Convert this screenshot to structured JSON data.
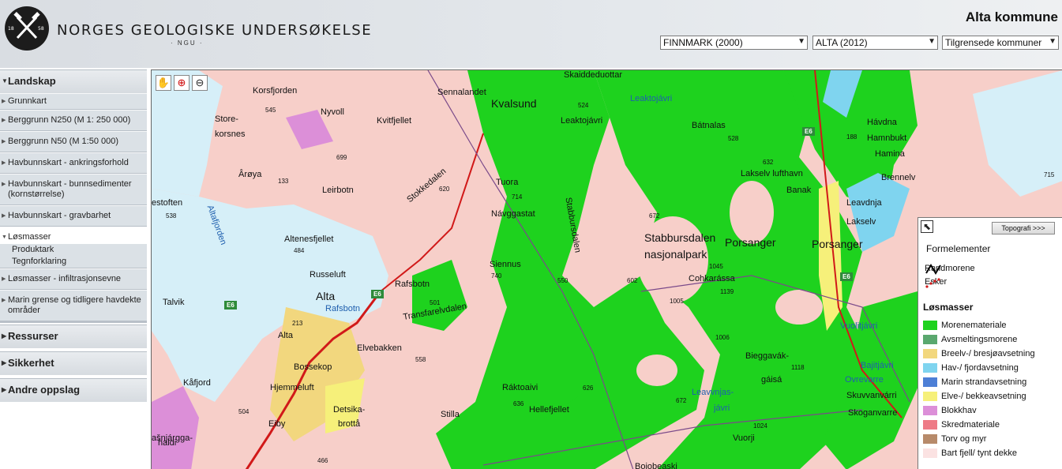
{
  "header": {
    "org_name": "NORGES GEOLOGISKE UNDERSØKELSE",
    "org_abbr": "· NGU ·",
    "logo_year_left": "18",
    "logo_year_right": "58",
    "kommune_title": "Alta kommune",
    "county_select": "FINNMARK (2000)",
    "municipality_select": "ALTA (2012)",
    "neighbors_select": "Tilgrensede kommuner"
  },
  "sidebar": {
    "categories": {
      "landskap": "Landskap",
      "ressurser": "Ressurser",
      "sikkerhet": "Sikkerhet",
      "andre": "Andre oppslag"
    },
    "items": [
      {
        "label": "Grunnkart"
      },
      {
        "label": "Berggrunn N250 (M 1: 250 000)"
      },
      {
        "label": "Berggrunn N50 (M 1:50 000)"
      },
      {
        "label": "Havbunnskart - ankringsforhold"
      },
      {
        "label": "Havbunnskart - bunnsedimenter (kornstørrelse)"
      },
      {
        "label": "Havbunnskart - gravbarhet"
      },
      {
        "label": "Løsmasser"
      },
      {
        "label": "Løsmasser - infiltrasjonsevne"
      },
      {
        "label": "Marin grense og tidligere havdekte områder"
      }
    ],
    "subitems": [
      "Produktark",
      "Tegnforklaring"
    ]
  },
  "map": {
    "labels": [
      "Store-",
      "korsnes",
      "Korsfjorden",
      "Nyvoll",
      "Kvitfjellet",
      "Sennalandet",
      "Kvalsund",
      "Ârøya",
      "Leirbotn",
      "Stokkedalen",
      "Tuora",
      "Návggastat",
      "Stabbursdalen",
      "Altafjorden",
      "Altenesfjellet",
      "Russeluft",
      "Rafsbotn",
      "Alta",
      "Rafsbotn",
      "Transfarelvdalen",
      "Siennus",
      "Stabbursdalen",
      "nasjonalpark",
      "Cohkarássa",
      "Porsanger",
      "Porsanger",
      "Lakselv lufthavn",
      "Banak",
      "Leavdnja",
      "Lakselv",
      "Hávdna",
      "Hamnbukt",
      "Hamina",
      "Brennelv",
      "Bátnalas",
      "Leaktojávri",
      "Leaktojávri",
      "Skaiddeduottar",
      "estoften",
      "Talvik",
      "Alta",
      "Elvebakken",
      "Bossekop",
      "Hjemmeluft",
      "Kåfjord",
      "Detsika-",
      "brottå",
      "Eiby",
      "Stilla",
      "Ráktoaivi",
      "Hellefjellet",
      "Bieggavák-",
      "gáisá",
      "Leavvnjas-",
      "jávri",
      "Vuorji",
      "Vuolitjávri",
      "Bajitjávri",
      "Ovrevarre",
      "Skuvvanvárri",
      "Skoganvarre",
      "ašnjárgga-",
      "haldi",
      "Bojobeaski"
    ],
    "numbers": [
      "545",
      "699",
      "133",
      "538",
      "484",
      "620",
      "714",
      "524",
      "528",
      "672",
      "632",
      "188",
      "715",
      "740",
      "550",
      "602",
      "1045",
      "1139",
      "1005",
      "1006",
      "1118",
      "213",
      "501",
      "558",
      "626",
      "636",
      "672",
      "1024",
      "504",
      "466"
    ],
    "road_shields": [
      "E6",
      "E6",
      "E6",
      "E6",
      "E6"
    ],
    "tools": [
      "pan-hand-icon",
      "zoom-in-icon",
      "zoom-out-icon"
    ]
  },
  "legend": {
    "topo_button": "Topografi >>>",
    "formelementer_title": "Formelementer",
    "randmorene": "Randmorene",
    "esker": "Esker",
    "losmasser_title": "Løsmasser",
    "entries": [
      {
        "label": "Morenemateriale",
        "color": "#1ed21e"
      },
      {
        "label": "Avsmeltingsmorene",
        "color": "#5aa86e"
      },
      {
        "label": "Breelv-/ bresjøavsetning",
        "color": "#f2d77e"
      },
      {
        "label": "Hav-/ fjordavsetning",
        "color": "#7fd4ef"
      },
      {
        "label": "Marin strandavsetning",
        "color": "#4d7fd6"
      },
      {
        "label": "Elve-/ bekkeavsetning",
        "color": "#f6f07a"
      },
      {
        "label": "Blokkhav",
        "color": "#dc8fd8"
      },
      {
        "label": "Skredmateriale",
        "color": "#ee7a86"
      },
      {
        "label": "Torv og myr",
        "color": "#b78a6a"
      },
      {
        "label": "Bart fjell/ tynt dekke",
        "color": "#fbe2e2"
      }
    ]
  }
}
